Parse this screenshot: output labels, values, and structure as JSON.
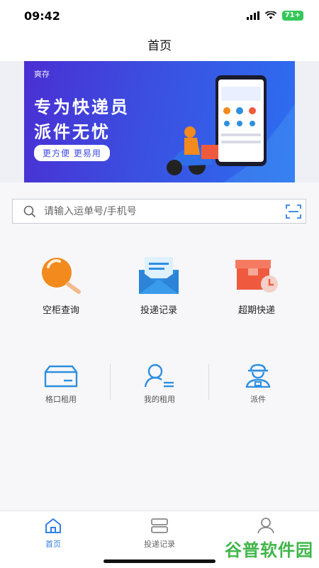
{
  "status": {
    "time": "09:42",
    "battery": "71+"
  },
  "nav": {
    "title": "首页"
  },
  "banner": {
    "logo": "爽存",
    "line1": "专为快递员",
    "line2": "派件无忧",
    "pill": "更方便 更易用"
  },
  "search": {
    "placeholder": "请输入运单号/手机号",
    "value": ""
  },
  "features": [
    {
      "label": "空柜查询",
      "icon": "magnifier-icon"
    },
    {
      "label": "投递记录",
      "icon": "envelope-icon"
    },
    {
      "label": "超期快递",
      "icon": "overdue-box-icon"
    }
  ],
  "services": [
    {
      "label": "格口租用",
      "icon": "box-icon"
    },
    {
      "label": "我的租用",
      "icon": "user-list-icon"
    },
    {
      "label": "派件",
      "icon": "courier-icon"
    }
  ],
  "tabs": [
    {
      "label": "首页",
      "icon": "home-icon",
      "active": true
    },
    {
      "label": "投递记录",
      "icon": "record-icon",
      "active": false
    },
    {
      "label": "",
      "icon": "profile-icon",
      "active": false
    }
  ],
  "watermark": {
    "text": "谷普软件园"
  },
  "colors": {
    "accent": "#2f7fe6",
    "orange": "#f28a1d",
    "blue_icon": "#2e8fe0",
    "red_icon": "#ef5a3f"
  }
}
